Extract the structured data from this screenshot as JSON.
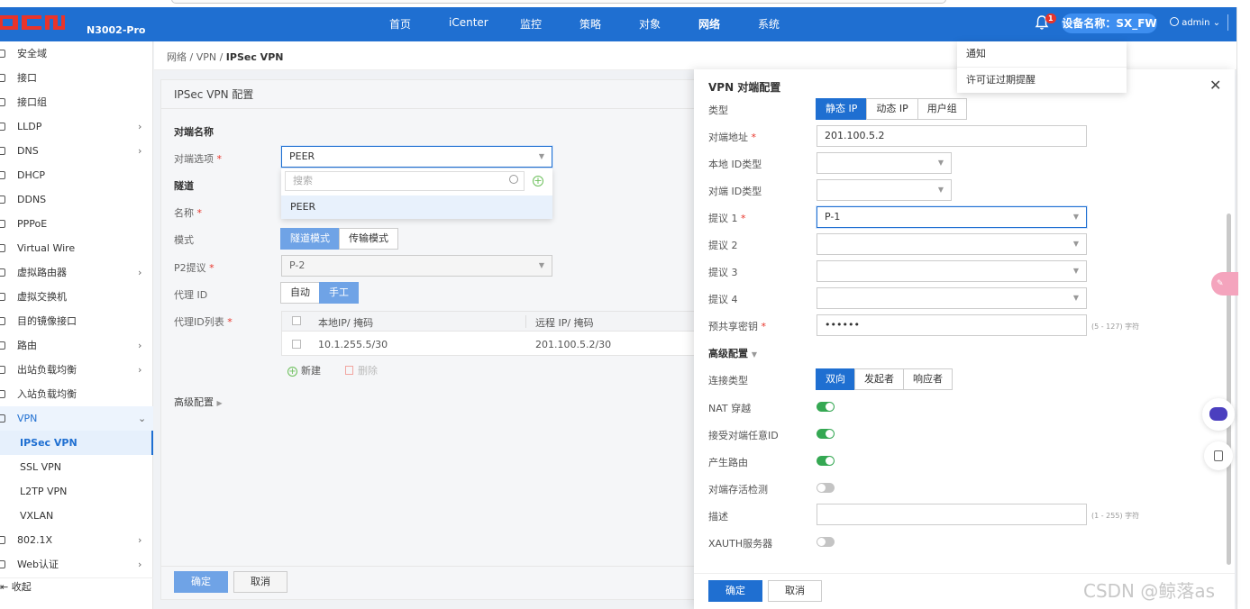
{
  "topbar": {
    "logo_text": "DCN",
    "model": "N3002-Pro",
    "nav": [
      "首页",
      "iCenter",
      "监控",
      "策略",
      "对象",
      "网络",
      "系统"
    ],
    "active_nav": "网络",
    "bell_badge": "1",
    "device_name": "设备名称：SX_FW",
    "user": "admin"
  },
  "notifications": [
    "通知",
    "许可证过期提醒"
  ],
  "sidebar": {
    "items": [
      {
        "label": "安全域",
        "chevron": false
      },
      {
        "label": "接口",
        "chevron": false
      },
      {
        "label": "接口组",
        "chevron": false
      },
      {
        "label": "LLDP",
        "chevron": true
      },
      {
        "label": "DNS",
        "chevron": true
      },
      {
        "label": "DHCP",
        "chevron": false
      },
      {
        "label": "DDNS",
        "chevron": false
      },
      {
        "label": "PPPoE",
        "chevron": false
      },
      {
        "label": "Virtual Wire",
        "chevron": false
      },
      {
        "label": "虚拟路由器",
        "chevron": true
      },
      {
        "label": "虚拟交换机",
        "chevron": false
      },
      {
        "label": "目的镜像接口",
        "chevron": false
      },
      {
        "label": "路由",
        "chevron": true
      },
      {
        "label": "出站负载均衡",
        "chevron": true
      },
      {
        "label": "入站负载均衡",
        "chevron": false
      },
      {
        "label": "VPN",
        "chevron": true,
        "expanded": true
      },
      {
        "label": "IPSec VPN",
        "sub": true,
        "active": true
      },
      {
        "label": "SSL VPN",
        "sub": true
      },
      {
        "label": "L2TP VPN",
        "sub": true
      },
      {
        "label": "VXLAN",
        "sub": true
      },
      {
        "label": "802.1X",
        "chevron": true
      },
      {
        "label": "Web认证",
        "chevron": true
      }
    ],
    "collapse_label": "收起"
  },
  "breadcrumb": {
    "path": "网络 / VPN / ",
    "current": "IPSec VPN"
  },
  "main": {
    "title": "IPSec VPN 配置",
    "peer_section": "对端名称",
    "peer_option_label": "对端选项",
    "peer_option_value": "PEER",
    "dropdown": {
      "search_placeholder": "搜索",
      "option": "PEER"
    },
    "tunnel_section": "隧道",
    "name_label": "名称",
    "mode_label": "模式",
    "mode_options": [
      "隧道模式",
      "传输模式"
    ],
    "mode_selected": "隧道模式",
    "p2_label": "P2提议",
    "p2_value": "P-2",
    "proxy_id_label": "代理 ID",
    "proxy_id_options": [
      "自动",
      "手工"
    ],
    "proxy_id_selected": "手工",
    "proxy_list_label": "代理ID列表",
    "table": {
      "headers": [
        "本地IP/ 掩码",
        "远程 IP/ 掩码"
      ],
      "rows": [
        [
          "10.1.255.5/30",
          "201.100.5.2/30"
        ]
      ]
    },
    "add_label": "新建",
    "delete_label": "删除",
    "advanced_label": "高级配置",
    "ok_label": "确定",
    "cancel_label": "取消"
  },
  "drawer": {
    "title": "VPN 对端配置",
    "type_label": "类型",
    "type_options": [
      "静态 IP",
      "动态 IP",
      "用户组"
    ],
    "type_selected": "静态 IP",
    "peer_addr_label": "对端地址",
    "peer_addr_value": "201.100.5.2",
    "local_id_type_label": "本地 ID类型",
    "peer_id_type_label": "对端 ID类型",
    "proposal1_label": "提议 1",
    "proposal1_value": "P-1",
    "proposal2_label": "提议 2",
    "proposal3_label": "提议 3",
    "proposal4_label": "提议 4",
    "psk_label": "预共享密钥",
    "psk_value": "••••••",
    "psk_hint": "(5 - 127) 字符",
    "advanced_label": "高级配置",
    "conn_type_label": "连接类型",
    "conn_type_options": [
      "双向",
      "发起者",
      "响应者"
    ],
    "conn_type_selected": "双向",
    "nat_label": "NAT 穿越",
    "nat_on": true,
    "accept_any_id_label": "接受对端任意ID",
    "accept_any_id_on": true,
    "gen_route_label": "产生路由",
    "gen_route_on": true,
    "dpd_label": "对端存活检测",
    "dpd_on": false,
    "desc_label": "描述",
    "desc_hint": "(1 - 255) 字符",
    "xauth_label": "XAUTH服务器",
    "xauth_on": false,
    "ok_label": "确定",
    "cancel_label": "取消"
  },
  "watermark": "CSDN @鲸落as",
  "colors": {
    "primary": "#1f6fd1",
    "toggle_on": "#35a853",
    "required": "#e8342a"
  }
}
